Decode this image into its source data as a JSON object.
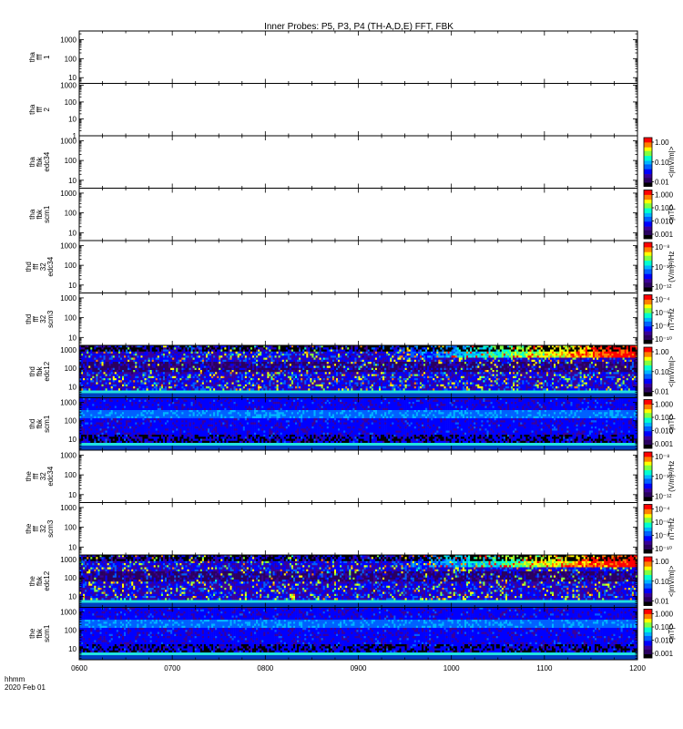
{
  "chart_data": {
    "type": "heatmap",
    "title": "Inner Probes: P5, P3, P4 (TH-A,D,E) FFT, FBK",
    "x_axis": {
      "ticks": [
        "0600",
        "0700",
        "0800",
        "0900",
        "1000",
        "1100",
        "1200"
      ],
      "label_line1": "hhmm",
      "label_line2": "2020 Feb 01"
    },
    "panels": [
      {
        "id": "p1",
        "ylabel": [
          "tha",
          "fff",
          "1"
        ],
        "yticks": [
          "1000",
          "100",
          "10"
        ],
        "ylog": [
          0.7,
          3.45
        ],
        "data": "none",
        "cbar": null
      },
      {
        "id": "p2",
        "ylabel": [
          "tha",
          "fff",
          "2"
        ],
        "yticks": [
          "1000",
          "100",
          "10",
          "1"
        ],
        "ylog": [
          0,
          3.1
        ],
        "data": "none",
        "cbar": null
      },
      {
        "id": "p3",
        "ylabel": [
          "tha",
          "fbk",
          "edc34"
        ],
        "yticks": [
          "1000",
          "100",
          "10"
        ],
        "ylog": [
          0.6,
          3.25
        ],
        "data": "none",
        "cbar": {
          "ticks": [
            "1.00",
            "0.10",
            "0.01"
          ],
          "unit": "<|mV/m|>"
        }
      },
      {
        "id": "p4",
        "ylabel": [
          "tha",
          "fbk",
          "scm1"
        ],
        "yticks": [
          "1000",
          "100",
          "10"
        ],
        "ylog": [
          0.6,
          3.25
        ],
        "data": "none",
        "cbar": {
          "ticks": [
            "1.000",
            "0.100",
            "0.010",
            "0.001"
          ],
          "unit": "<|nT|>"
        }
      },
      {
        "id": "p5",
        "ylabel": [
          "thd",
          "fff",
          "32",
          "edc34"
        ],
        "yticks": [
          "1000",
          "100",
          "10"
        ],
        "ylog": [
          0.6,
          3.25
        ],
        "data": "none",
        "cbar": {
          "ticks": [
            "10⁻⁸",
            "10⁻¹⁰",
            "10⁻¹²"
          ],
          "unit": "(V/m)²/Hz"
        }
      },
      {
        "id": "p6",
        "ylabel": [
          "thd",
          "fff",
          "32",
          "scm3"
        ],
        "yticks": [
          "1000",
          "100",
          "10"
        ],
        "ylog": [
          0.6,
          3.25
        ],
        "data": "none",
        "cbar": {
          "ticks": [
            "10⁻⁴",
            "10⁻⁶",
            "10⁻⁸",
            "10⁻¹⁰"
          ],
          "unit": "nT²/Hz"
        }
      },
      {
        "id": "p7",
        "ylabel": [
          "thd",
          "fbk",
          "edc12"
        ],
        "yticks": [
          "1000",
          "100",
          "10"
        ],
        "ylog": [
          0.4,
          3.25
        ],
        "data": "edc",
        "cbar": {
          "ticks": [
            "1.00",
            "0.10",
            "0.01"
          ],
          "unit": "<|mV/m|>"
        }
      },
      {
        "id": "p8",
        "ylabel": [
          "thd",
          "fbk",
          "scm1"
        ],
        "yticks": [
          "1000",
          "100",
          "10"
        ],
        "ylog": [
          0.4,
          3.25
        ],
        "data": "scm",
        "cbar": {
          "ticks": [
            "1.000",
            "0.100",
            "0.010",
            "0.001"
          ],
          "unit": "<|nT|>"
        }
      },
      {
        "id": "p9",
        "ylabel": [
          "the",
          "fff",
          "32",
          "edc34"
        ],
        "yticks": [
          "1000",
          "100",
          "10"
        ],
        "ylog": [
          0.6,
          3.25
        ],
        "data": "none",
        "cbar": {
          "ticks": [
            "10⁻⁸",
            "10⁻¹⁰",
            "10⁻¹²"
          ],
          "unit": "(V/m)²/Hz"
        }
      },
      {
        "id": "p10",
        "ylabel": [
          "the",
          "fff",
          "32",
          "scm3"
        ],
        "yticks": [
          "1000",
          "100",
          "10"
        ],
        "ylog": [
          0.6,
          3.25
        ],
        "data": "none",
        "cbar": {
          "ticks": [
            "10⁻⁴",
            "10⁻⁶",
            "10⁻⁸",
            "10⁻¹⁰"
          ],
          "unit": "nT²/Hz"
        }
      },
      {
        "id": "p11",
        "ylabel": [
          "the",
          "fbk",
          "edc12"
        ],
        "yticks": [
          "1000",
          "100",
          "10"
        ],
        "ylog": [
          0.4,
          3.25
        ],
        "data": "edc",
        "cbar": {
          "ticks": [
            "1.00",
            "0.10",
            "0.01"
          ],
          "unit": "<|mV/m|>"
        }
      },
      {
        "id": "p12",
        "ylabel": [
          "the",
          "fbk",
          "scm1"
        ],
        "yticks": [
          "1000",
          "100",
          "10"
        ],
        "ylog": [
          0.4,
          3.25
        ],
        "data": "scm",
        "cbar": {
          "ticks": [
            "1.000",
            "0.100",
            "0.010",
            "0.001"
          ],
          "unit": "<|nT|>"
        }
      }
    ]
  },
  "colors": {
    "axis": "#000000",
    "colormap": [
      "#000000",
      "#2a0060",
      "#3a0098",
      "#0000ff",
      "#0060ff",
      "#00b4ff",
      "#00ffd0",
      "#80ff40",
      "#ffff00",
      "#ff8000",
      "#ff0000",
      "#ffffff"
    ]
  }
}
